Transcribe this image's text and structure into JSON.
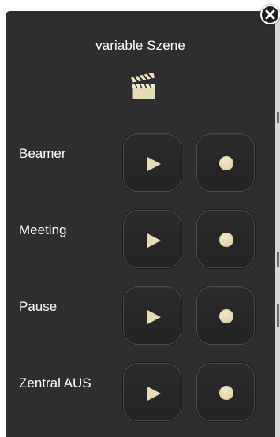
{
  "popup": {
    "title": "variable Szene",
    "header_icon": "clapperboard-icon",
    "close_icon": "close-icon"
  },
  "rows": [
    {
      "label": "Beamer",
      "play_icon": "play-icon",
      "record_icon": "dot-icon"
    },
    {
      "label": "Meeting",
      "play_icon": "play-icon",
      "record_icon": "dot-icon"
    },
    {
      "label": "Pause",
      "play_icon": "play-icon",
      "record_icon": "dot-icon"
    },
    {
      "label": "Zentral AUS",
      "play_icon": "play-icon",
      "record_icon": "dot-icon"
    }
  ],
  "colors": {
    "panel_background": "#2e2e2e",
    "button_border": "#4a4a4a",
    "glyph_cream": "#e8dcb8",
    "text": "#ffffff"
  }
}
